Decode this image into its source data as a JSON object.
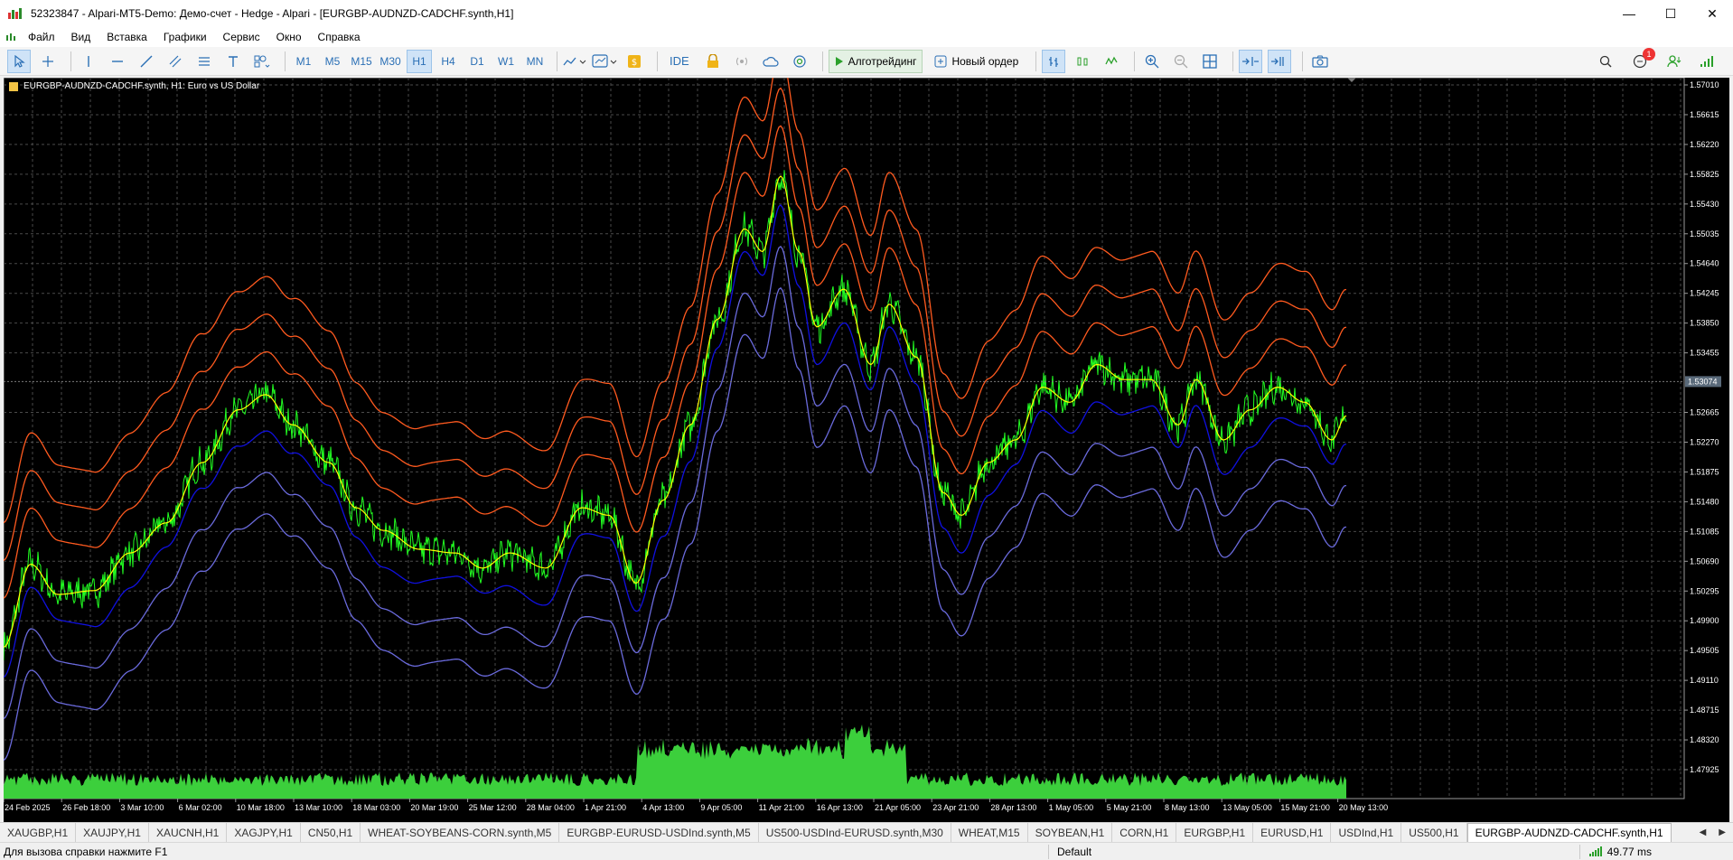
{
  "window": {
    "title": "52323847 - Alpari-MT5-Demo: Демо-счет - Hedge - Alpari - [EURGBP-AUDNZD-CADCHF.synth,H1]",
    "minimize": "—",
    "maximize": "☐",
    "close": "✕"
  },
  "menu": {
    "items": [
      "Файл",
      "Вид",
      "Вставка",
      "Графики",
      "Сервис",
      "Окно",
      "Справка"
    ]
  },
  "toolbar": {
    "timeframes": [
      "M1",
      "M5",
      "M15",
      "M30",
      "H1",
      "H4",
      "D1",
      "W1",
      "MN"
    ],
    "active_timeframe": "H1",
    "ide_label": "IDE",
    "algo_label": "Алготрейдинг",
    "new_order_label": "Новый ордер",
    "notification_count": "1"
  },
  "chart": {
    "info": "EURGBP-AUDNZD-CADCHF.synth, H1:  Euro vs US Dollar",
    "current_price": "1.53074",
    "price_labels": [
      "1.57010",
      "1.56615",
      "1.56220",
      "1.55825",
      "1.55430",
      "1.55035",
      "1.54640",
      "1.54245",
      "1.53850",
      "1.53455",
      "1.53074",
      "1.52665",
      "1.52270",
      "1.51875",
      "1.51480",
      "1.51085",
      "1.50690",
      "1.50295",
      "1.49900",
      "1.49505",
      "1.49110",
      "1.48715",
      "1.48320",
      "1.47925"
    ],
    "time_labels": [
      "24 Feb 2025",
      "26 Feb 18:00",
      "3 Mar 10:00",
      "6 Mar 02:00",
      "10 Mar 18:00",
      "13 Mar 10:00",
      "18 Mar 03:00",
      "20 Mar 19:00",
      "25 Mar 12:00",
      "28 Mar 04:00",
      "1 Apr 21:00",
      "4 Apr 13:00",
      "9 Apr 05:00",
      "11 Apr 21:00",
      "16 Apr 13:00",
      "21 Apr 05:00",
      "23 Apr 21:00",
      "28 Apr 13:00",
      "1 May 05:00",
      "5 May 21:00",
      "8 May 13:00",
      "13 May 05:00",
      "15 May 21:00",
      "20 May 13:00"
    ],
    "colors": {
      "background": "#000000",
      "grid": "#4a4a4a",
      "price": "#22ff22",
      "ma": "#ffff00",
      "upper_band": "#ff5a1f",
      "mid_low_band": "#1010e0",
      "lower_band": "#6a6adc",
      "volume": "#3ccf3c"
    }
  },
  "tabs": {
    "items": [
      "XAUGBP,H1",
      "XAUJPY,H1",
      "XAUCNH,H1",
      "XAGJPY,H1",
      "CN50,H1",
      "WHEAT-SOYBEANS-CORN.synth,M5",
      "EURGBP-EURUSD-USDInd.synth,M5",
      "US500-USDInd-EURUSD.synth,M30",
      "WHEAT,M15",
      "SOYBEAN,H1",
      "CORN,H1",
      "EURGBP,H1",
      "EURUSD,H1",
      "USDInd,H1",
      "US500,H1",
      "EURGBP-AUDNZD-CADCHF.synth,H1"
    ],
    "active": "EURGBP-AUDNZD-CADCHF.synth,H1"
  },
  "status": {
    "help": "Для вызова справки нажмите F1",
    "profile": "Default",
    "ping": "49.77 ms"
  }
}
